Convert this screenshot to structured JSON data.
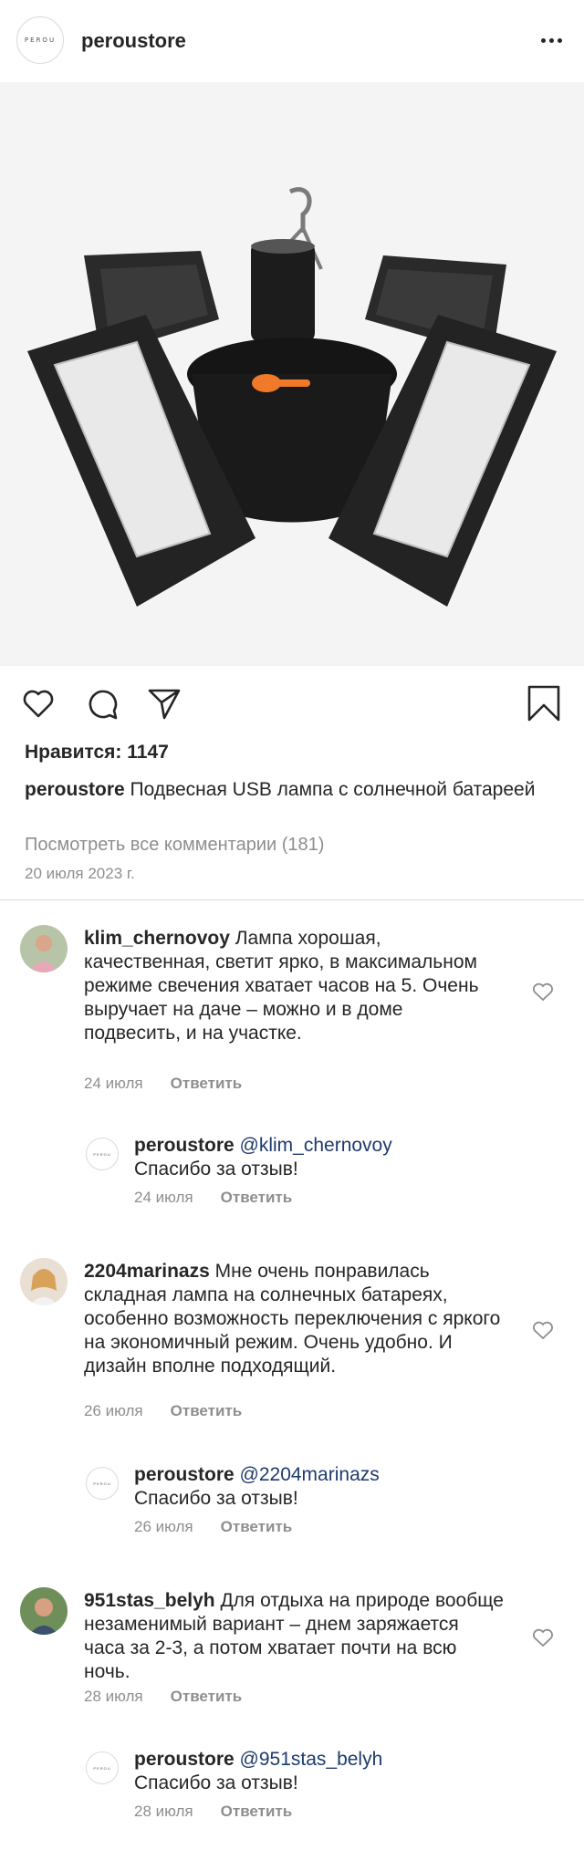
{
  "header": {
    "logo_text": "PEROU",
    "username": "peroustore"
  },
  "post": {
    "image_alt": "Подвесная USB лампа с солнечной батареей",
    "likes_label": "Нравится: 1147",
    "caption_user": "peroustore",
    "caption_text": " Подвесная USB лампа с солнечной батареей",
    "view_all": "Посмотреть все комментарии (181)",
    "date": "20 июля 2023 г."
  },
  "comments": [
    {
      "user": "klim_chernovoy",
      "text": " Лампа хорошая, качественная, светит ярко, в максимальном режиме свечения хватает часов на 5. Очень выручает на даче – можно и в доме подвесить, и на участке.",
      "date": "24 июля",
      "reply_label": "Ответить",
      "reply": {
        "user": "peroustore",
        "mention": " @klim_chernovoy",
        "text": "Спасибо за отзыв!",
        "date": "24 июля",
        "reply_label": "Ответить"
      }
    },
    {
      "user": "2204marinazs",
      "text": " Мне очень понравилась складная лампа на солнечных батареях, особенно возможность переключения с яркого на экономичный режим. Очень удобно. И дизайн вполне подходящий.",
      "date": "26 июля",
      "reply_label": "Ответить",
      "reply": {
        "user": "peroustore",
        "mention": " @2204marinazs",
        "text": "Спасибо за отзыв!",
        "date": "26 июля",
        "reply_label": "Ответить"
      }
    },
    {
      "user": "951stas_belyh",
      "text": " Для отдыха на природе вообще незаменимый вариант – днем заряжается часа за 2-3, а потом хватает почти на всю ночь.",
      "date": "28 июля",
      "reply_label": "Ответить",
      "reply": {
        "user": "peroustore",
        "mention": " @951stas_belyh",
        "text": "Спасибо за отзыв!",
        "date": "28 июля",
        "reply_label": "Ответить"
      }
    }
  ],
  "colors": {
    "text": "#262626",
    "muted": "#8e8e8e",
    "divider": "#dbdbdb",
    "mention": "#1e3a6e",
    "accent_orange": "#f07a2a"
  }
}
